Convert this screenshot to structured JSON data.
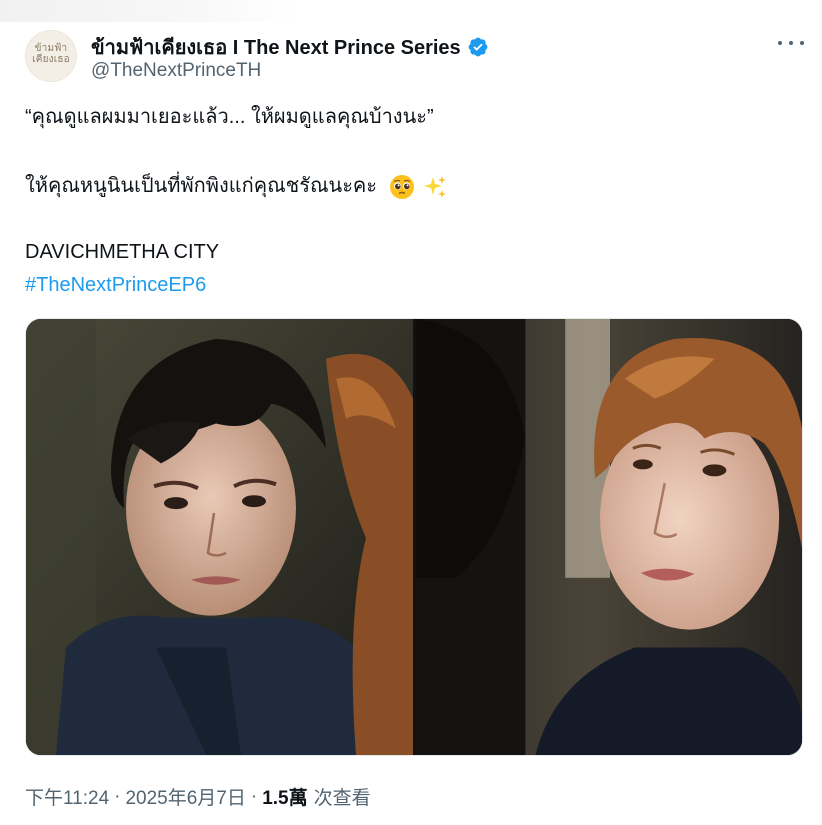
{
  "author": {
    "display_name": "ข้ามฟ้าเคียงเธอ I The Next Prince Series",
    "handle": "@TheNextPrinceTH",
    "verified": true,
    "avatar_logo_line1": "ข้ามฟ้า",
    "avatar_logo_line2": "เคียงเธอ"
  },
  "tweet": {
    "line1": "“คุณดูแลผมมาเยอะแล้ว... ให้ผมดูแลคุณบ้างนะ”",
    "line2": "ให้คุณหนูนินเป็นที่พักพิงแก่คุณชรัณนะคะ",
    "line2_emojis": [
      "pleading-face-emoji",
      "sparkles-emoji"
    ],
    "line3": "DAVICHMETHA CITY",
    "hashtag": "#TheNextPrinceEP6"
  },
  "media": {
    "count": 2,
    "images": [
      "photo-left-dark-haired-man",
      "photo-right-auburn-haired-man"
    ]
  },
  "meta": {
    "time": "下午11:24",
    "date": "2025年6月7日",
    "separator": "·",
    "views_count": "1.5萬",
    "views_label": "次查看"
  },
  "colors": {
    "text": "#0f1419",
    "secondary": "#536471",
    "link": "#1d9bf0",
    "verified": "#1d9bf0"
  }
}
